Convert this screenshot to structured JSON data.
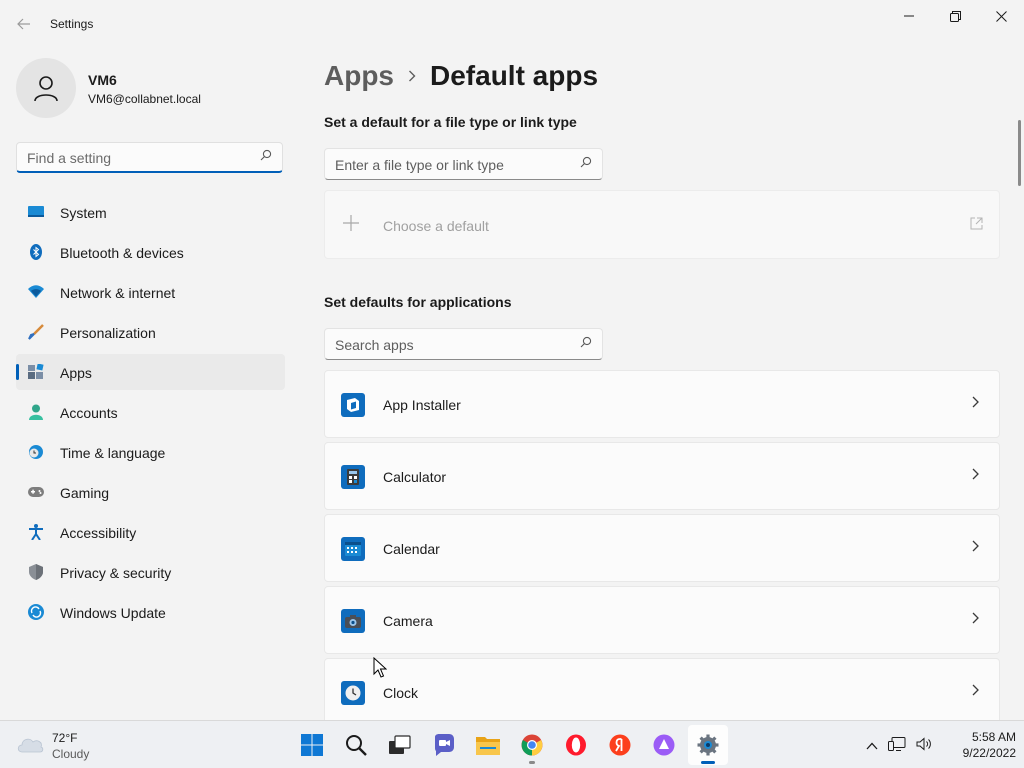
{
  "window": {
    "title": "Settings"
  },
  "profile": {
    "name": "VM6",
    "email": "VM6@collabnet.local"
  },
  "sidebar": {
    "search_placeholder": "Find a setting",
    "items": [
      {
        "label": "System",
        "icon": "system-icon"
      },
      {
        "label": "Bluetooth & devices",
        "icon": "bluetooth-icon"
      },
      {
        "label": "Network & internet",
        "icon": "wifi-icon"
      },
      {
        "label": "Personalization",
        "icon": "brush-icon"
      },
      {
        "label": "Apps",
        "icon": "apps-icon",
        "active": true
      },
      {
        "label": "Accounts",
        "icon": "accounts-icon"
      },
      {
        "label": "Time & language",
        "icon": "clock-globe-icon"
      },
      {
        "label": "Gaming",
        "icon": "gamepad-icon"
      },
      {
        "label": "Accessibility",
        "icon": "accessibility-icon"
      },
      {
        "label": "Privacy & security",
        "icon": "shield-icon"
      },
      {
        "label": "Windows Update",
        "icon": "update-icon"
      }
    ]
  },
  "main": {
    "breadcrumb_parent": "Apps",
    "breadcrumb_current": "Default apps",
    "filetype_section_title": "Set a default for a file type or link type",
    "filetype_search_placeholder": "Enter a file type or link type",
    "choose_default_label": "Choose a default",
    "apps_section_title": "Set defaults for applications",
    "apps_search_placeholder": "Search apps",
    "apps": [
      {
        "name": "App Installer",
        "icon": "app-installer-icon"
      },
      {
        "name": "Calculator",
        "icon": "calculator-icon"
      },
      {
        "name": "Calendar",
        "icon": "calendar-icon"
      },
      {
        "name": "Camera",
        "icon": "camera-icon"
      },
      {
        "name": "Clock",
        "icon": "clock-icon"
      }
    ]
  },
  "taskbar": {
    "weather_temp": "72°F",
    "weather_condition": "Cloudy",
    "time": "5:58 AM",
    "date": "9/22/2022",
    "pinned": [
      "start-icon",
      "search-icon",
      "task-view-icon",
      "chat-icon",
      "file-explorer-icon",
      "chrome-icon",
      "opera-icon",
      "yandex-icon",
      "alice-icon",
      "settings-icon"
    ]
  },
  "colors": {
    "accent": "#005fb8",
    "background": "#f3f3f3",
    "card": "#fbfbfb"
  }
}
